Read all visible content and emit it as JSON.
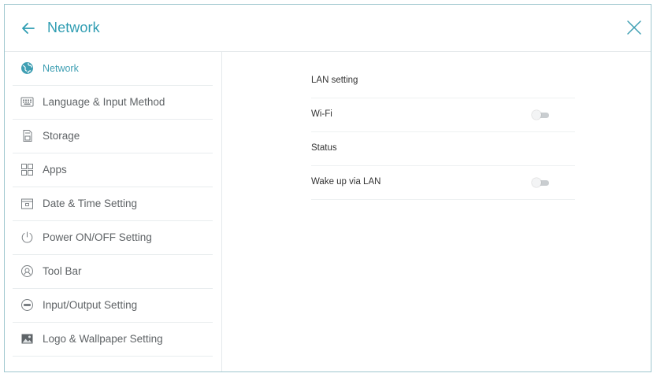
{
  "header": {
    "title": "Network"
  },
  "sidebar": {
    "items": [
      {
        "label": "Network",
        "icon": "globe-icon"
      },
      {
        "label": "Language & Input Method",
        "icon": "keyboard-icon"
      },
      {
        "label": "Storage",
        "icon": "storage-icon"
      },
      {
        "label": "Apps",
        "icon": "apps-grid-icon"
      },
      {
        "label": "Date & Time Setting",
        "icon": "calendar-icon"
      },
      {
        "label": "Power ON/OFF Setting",
        "icon": "power-icon"
      },
      {
        "label": "Tool Bar",
        "icon": "toolbar-icon"
      },
      {
        "label": "Input/Output Setting",
        "icon": "input-output-icon"
      },
      {
        "label": "Logo & Wallpaper Setting",
        "icon": "wallpaper-icon"
      }
    ],
    "active_index": 0
  },
  "content": {
    "rows": [
      {
        "label": "LAN setting"
      },
      {
        "label": "Wi-Fi",
        "toggle": "off"
      },
      {
        "label": "Status"
      },
      {
        "label": "Wake up via LAN",
        "toggle": "off"
      }
    ]
  },
  "colors": {
    "accent": "#2f9db2",
    "border": "#9fc7cf",
    "toggle_off": "#c9cdd0"
  }
}
